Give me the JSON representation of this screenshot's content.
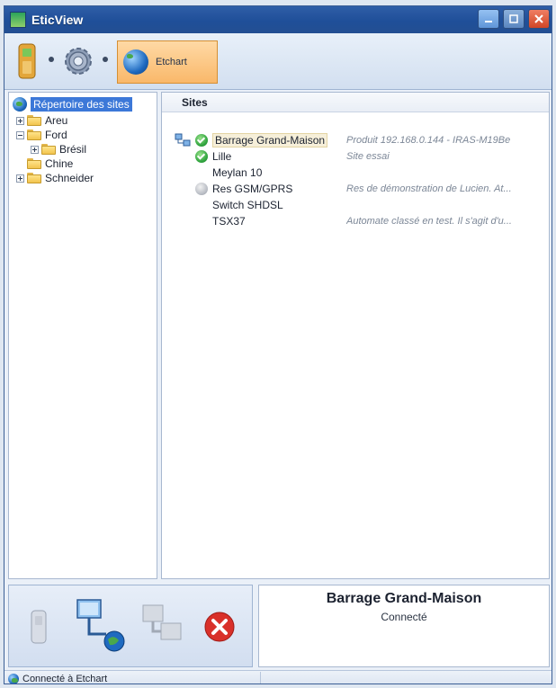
{
  "window": {
    "title": "EticView",
    "buttons": {
      "minimize": "minimize",
      "maximize": "maximize",
      "close": "close"
    }
  },
  "toolbar": {
    "tools": [
      {
        "icon": "device-icon"
      },
      {
        "icon": "gear-icon"
      },
      {
        "icon": "globe-icon",
        "label": "Etchart",
        "active": true
      }
    ]
  },
  "tree": {
    "root": "Répertoire des sites",
    "items": [
      {
        "label": "Areu",
        "expanded": false
      },
      {
        "label": "Ford",
        "expanded": true
      },
      {
        "label": "Brésil",
        "expanded": false
      },
      {
        "label": "Chine"
      },
      {
        "label": "Schneider",
        "expanded": false
      }
    ]
  },
  "sites": {
    "header": "Sites",
    "rows": [
      {
        "name": "Barrage Grand-Maison",
        "status": "ok",
        "desc": "Produit 192.168.0.144 - IRAS-M19Be"
      },
      {
        "name": "Lille",
        "status": "ok",
        "desc": "Site essai"
      },
      {
        "name": "Meylan 10",
        "status": "",
        "desc": ""
      },
      {
        "name": "Res GSM/GPRS",
        "status": "gray",
        "desc": "Res de démonstration de Lucien. At..."
      },
      {
        "name": "Switch SHDSL",
        "status": "",
        "desc": ""
      },
      {
        "name": "TSX37",
        "status": "",
        "desc": "Automate classé en test. Il s'agit d'u..."
      }
    ]
  },
  "selected_site": {
    "name": "Barrage Grand-Maison",
    "status": "Connecté"
  },
  "statusbar": {
    "text": "Connecté à Etchart"
  },
  "colors": {
    "titlebar": "#2f5ea7",
    "selection": "#3c78d8",
    "active_tool": "#f9b86a",
    "ok": "#2ea33d",
    "error": "#d9302a"
  }
}
